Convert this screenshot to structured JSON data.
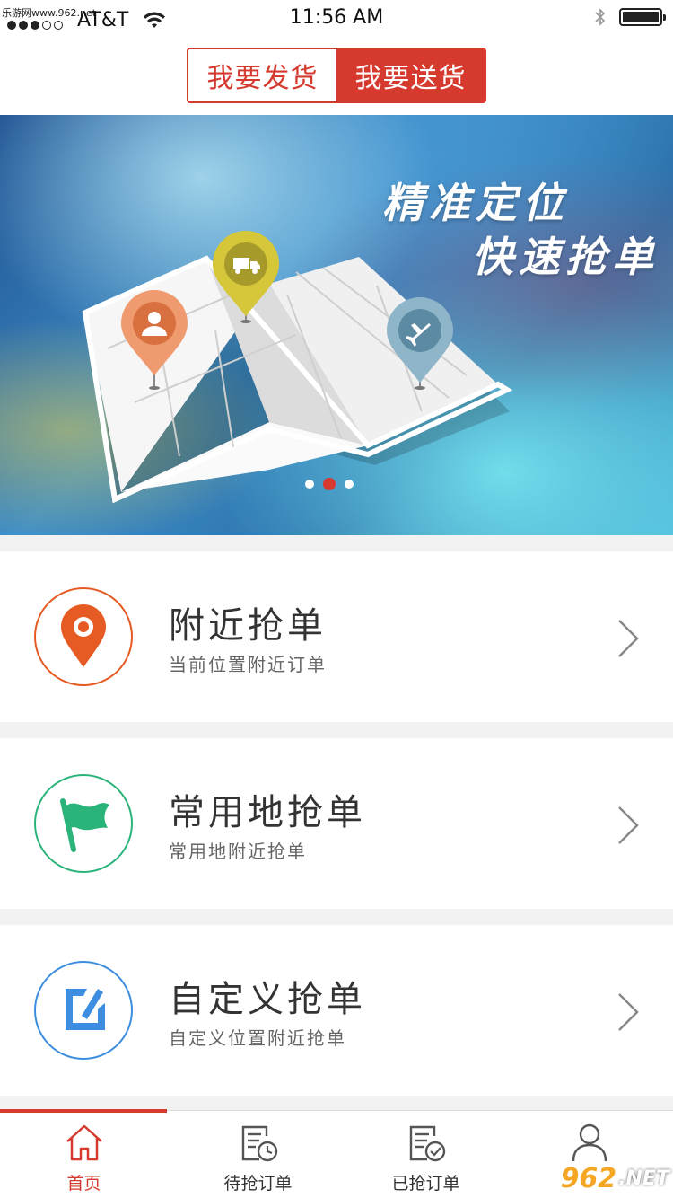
{
  "status_bar": {
    "watermark": "乐游网www.962.net",
    "carrier": "AT&T",
    "time": "11:56 AM",
    "signal_bars_filled": 3,
    "signal_bars_total": 5,
    "battery_level": 1.0
  },
  "header": {
    "tabs": [
      {
        "label": "我要发货",
        "active": false
      },
      {
        "label": "我要送货",
        "active": true
      }
    ]
  },
  "banner": {
    "headline_line1": "精准定位",
    "headline_line2": "快速抢单",
    "carousel_pages": 3,
    "carousel_active_index": 1,
    "pins": [
      "person-icon",
      "truck-icon",
      "airplane-icon"
    ]
  },
  "menu": [
    {
      "title": "附近抢单",
      "subtitle": "当前位置附近订单",
      "icon": "location-pin-icon",
      "color": "#e65a24"
    },
    {
      "title": "常用地抢单",
      "subtitle": "常用地附近抢单",
      "icon": "flag-icon",
      "color": "#2bb47a"
    },
    {
      "title": "自定义抢单",
      "subtitle": "自定义位置附近抢单",
      "icon": "edit-icon",
      "color": "#3d8ee0"
    }
  ],
  "tabbar": {
    "items": [
      {
        "label": "首页",
        "icon": "home-icon",
        "active": true
      },
      {
        "label": "待抢订单",
        "icon": "pending-order-icon",
        "active": false
      },
      {
        "label": "已抢订单",
        "icon": "grabbed-order-icon",
        "active": false
      },
      {
        "label": "",
        "icon": "profile-icon",
        "active": false
      }
    ]
  },
  "watermark_logo": {
    "part1": "962",
    "part2": ".NET",
    "sub": "乐游网"
  },
  "colors": {
    "accent": "#d63a2f",
    "background": "#f2f2f2"
  }
}
